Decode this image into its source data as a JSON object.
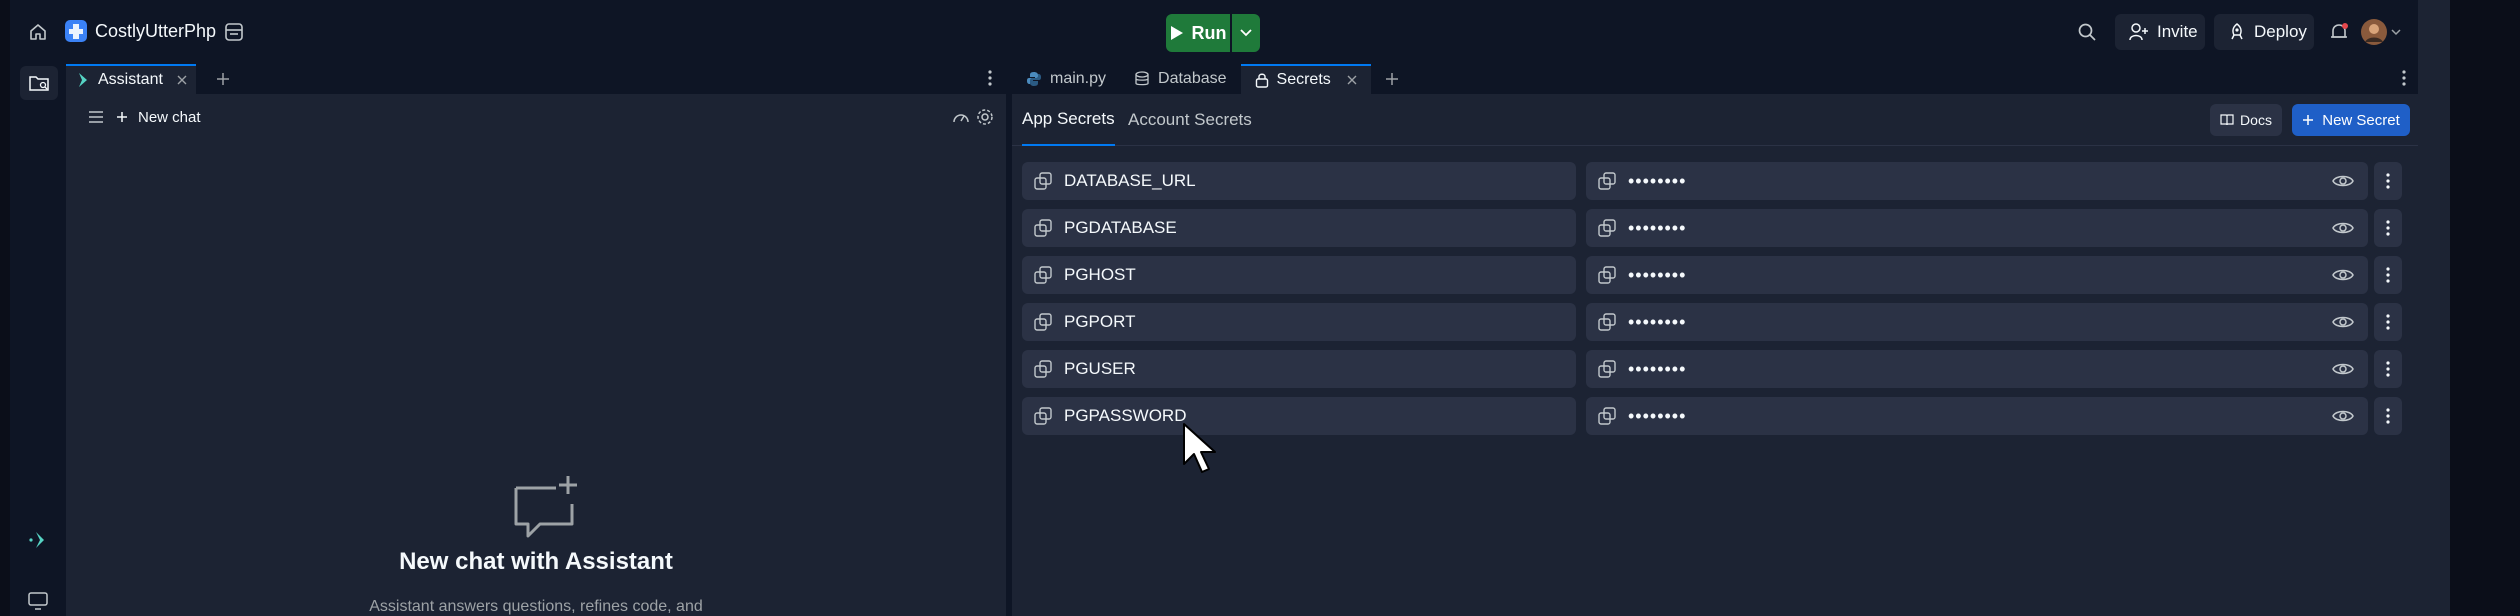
{
  "colors": {
    "background": "#0e1525",
    "surface": "#1c2333",
    "field": "#2b3245",
    "run_green": "#1f7a3a",
    "primary_blue": "#1f5fc7",
    "accent_blue": "#0079f2",
    "notification": "#e5484d"
  },
  "topbar": {
    "project_name": "CostlyUtterPhp",
    "run_label": "Run",
    "invite_label": "Invite",
    "deploy_label": "Deploy",
    "icons": [
      "home-icon",
      "project-logo-icon",
      "layout-icon",
      "play-icon",
      "chevron-down-icon",
      "search-icon",
      "user-plus-icon",
      "deploy-icon",
      "bell-icon",
      "avatar"
    ]
  },
  "leftrail": {
    "icons": [
      "file-explorer-icon",
      "assistant-icon",
      "desktop-icon"
    ]
  },
  "assistant": {
    "tab_label": "Assistant",
    "new_chat_label": "New chat",
    "empty_title": "New chat with Assistant",
    "empty_desc": "Assistant answers questions, refines code, and"
  },
  "main": {
    "tabs": [
      {
        "label": "main.py",
        "icon": "python-icon",
        "active": false
      },
      {
        "label": "Database",
        "icon": "database-icon",
        "active": false
      },
      {
        "label": "Secrets",
        "icon": "lock-icon",
        "active": true
      }
    ],
    "subtabs": [
      {
        "label": "App Secrets",
        "active": true
      },
      {
        "label": "Account Secrets",
        "active": false
      }
    ],
    "docs_label": "Docs",
    "new_secret_label": "New Secret",
    "secrets": [
      {
        "key": "DATABASE_URL",
        "value": "••••••••"
      },
      {
        "key": "PGDATABASE",
        "value": "••••••••"
      },
      {
        "key": "PGHOST",
        "value": "••••••••"
      },
      {
        "key": "PGPORT",
        "value": "••••••••"
      },
      {
        "key": "PGUSER",
        "value": "••••••••"
      },
      {
        "key": "PGPASSWORD",
        "value": "••••••••"
      }
    ]
  }
}
